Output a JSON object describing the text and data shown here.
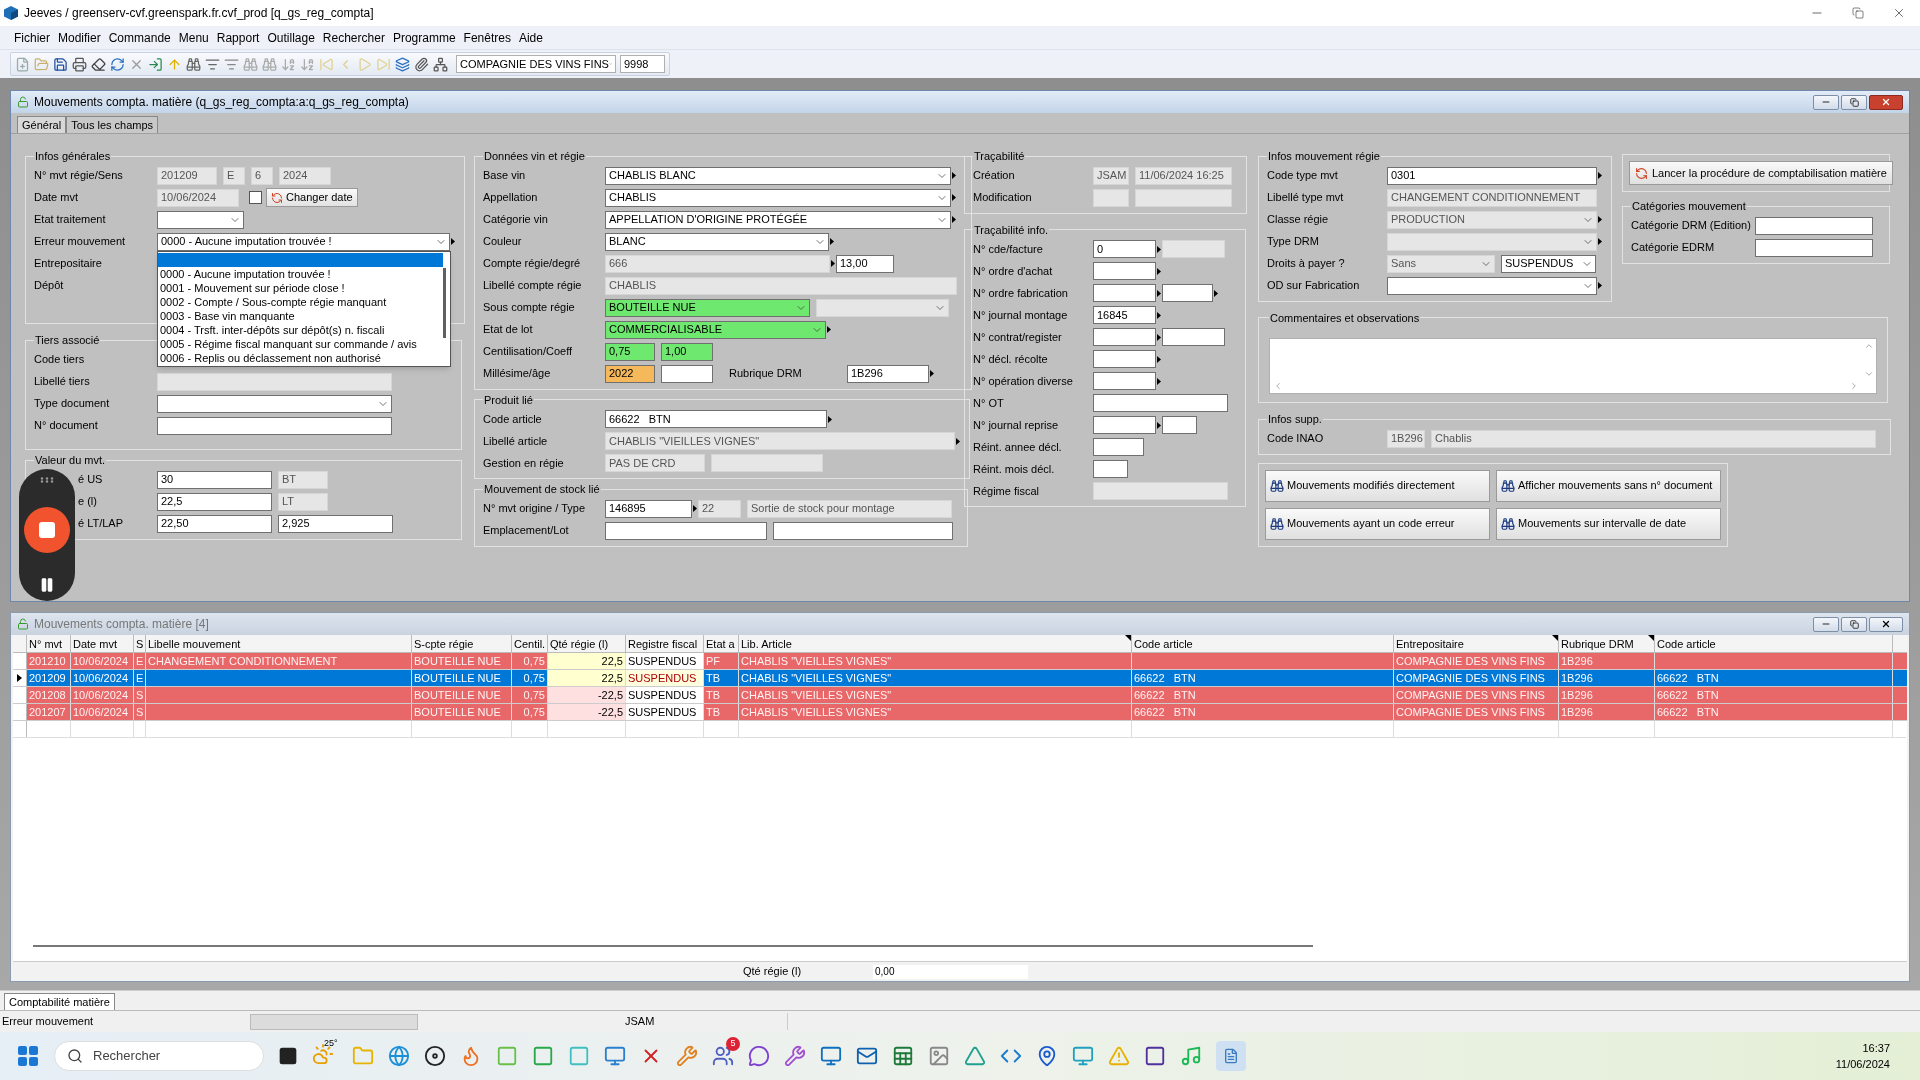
{
  "app": {
    "title": "Jeeves / greenserv-cvf.greenspark.fr.cvf_prod [q_gs_reg_compta]"
  },
  "menu": [
    "Fichier",
    "Modifier",
    "Commande",
    "Menu",
    "Rapport",
    "Outillage",
    "Rechercher",
    "Programme",
    "Fenêtres",
    "Aide"
  ],
  "toolbar": {
    "company": "COMPAGNIE DES VINS FINS",
    "code": "9998"
  },
  "form_window": {
    "title": "Mouvements compta. matière (q_gs_reg_compta:a:q_gs_reg_compta)",
    "tabs": [
      {
        "label": "Général",
        "selected": true
      },
      {
        "label": "Tous les champs",
        "selected": false
      }
    ],
    "infos_generales": {
      "title": "Infos générales",
      "rows": [
        {
          "label": "N° mvt régie/Sens",
          "fields": [
            {
              "kind": "input",
              "readonly": true,
              "link": false,
              "value": "201209"
            },
            {
              "kind": "input",
              "readonly": true,
              "link": false,
              "value": "E"
            },
            {
              "kind": "input",
              "readonly": true,
              "link": false,
              "value": "6"
            },
            {
              "kind": "input",
              "readonly": true,
              "link": false,
              "value": "2024"
            }
          ]
        },
        {
          "label": "Date mvt",
          "fields": [
            {
              "kind": "input",
              "readonly": true,
              "link": false,
              "value": "10/06/2024"
            }
          ],
          "checkbox": {
            "checked": false
          },
          "button": "Changer date"
        },
        {
          "label": "Etat traitement",
          "fields": [
            {
              "kind": "select",
              "readonly": false,
              "link": false
            }
          ]
        },
        {
          "label": "Erreur mouvement",
          "fields": [
            {
              "kind": "select",
              "readonly": false,
              "link": true,
              "value": "0000 - Aucune imputation trouvée !"
            }
          ],
          "dropdown": [
            {
              "selected": true
            },
            {
              "label": "0000 - Aucune imputation trouvée !",
              "selected": false
            },
            {
              "label": "0001 - Mouvement sur période close !",
              "selected": false
            },
            {
              "label": "0002 - Compte / Sous-compte régie manquant",
              "selected": false
            },
            {
              "label": "0003 - Base vin manquante",
              "selected": false
            },
            {
              "label": "0004 - Trsft. inter-dépôts sur dépôt(s) n. fiscali",
              "selected": false
            },
            {
              "label": "0005 - Régime fiscal manquant sur commande / avis",
              "selected": false
            },
            {
              "label": "0006 - Replis ou déclassement non authorisé",
              "selected": false
            }
          ]
        },
        {
          "label": "Entrepositaire"
        },
        {
          "label": "Dépôt"
        }
      ]
    },
    "tiers": {
      "title": "Tiers associé",
      "rows": [
        {
          "label": "Code tiers"
        },
        {
          "label": "Libellé tiers",
          "fields": [
            {
              "kind": "input",
              "readonly": true,
              "link": false
            }
          ]
        },
        {
          "label": "Type document",
          "fields": [
            {
              "kind": "select",
              "readonly": false,
              "link": false
            }
          ]
        },
        {
          "label": "N° document",
          "fields": [
            {
              "kind": "input",
              "readonly": false,
              "link": false
            }
          ]
        }
      ]
    },
    "valeur": {
      "title": "Valeur du mvt.",
      "rows": [
        {
          "label": "é US",
          "fields": [
            {
              "kind": "input",
              "readonly": false,
              "link": false,
              "value": "30"
            },
            {
              "kind": "input",
              "readonly": true,
              "link": false,
              "value": "BT"
            }
          ]
        },
        {
          "label": "e (l)",
          "fields": [
            {
              "kind": "input",
              "readonly": false,
              "link": false,
              "value": "22,5"
            },
            {
              "kind": "input",
              "readonly": true,
              "link": false,
              "value": "LT"
            }
          ]
        },
        {
          "label": "é LT/LAP",
          "fields": [
            {
              "kind": "input",
              "readonly": false,
              "link": false,
              "value": "22,50"
            },
            {
              "kind": "input",
              "readonly": false,
              "link": false,
              "value": "2,925"
            }
          ]
        }
      ]
    },
    "vin": {
      "title": "Données vin et régie",
      "rows": [
        {
          "label": "Base vin",
          "fields": [
            {
              "kind": "select",
              "readonly": false,
              "link": true,
              "value": "CHABLIS BLANC"
            }
          ]
        },
        {
          "label": "Appellation",
          "fields": [
            {
              "kind": "select",
              "readonly": false,
              "link": true,
              "value": "CHABLIS"
            }
          ]
        },
        {
          "label": "Catégorie vin",
          "fields": [
            {
              "kind": "select",
              "readonly": false,
              "link": true,
              "value": "APPELLATION D'ORIGINE PROTÉGÉE"
            }
          ]
        },
        {
          "label": "Couleur",
          "fields": [
            {
              "kind": "select",
              "readonly": false,
              "link": true,
              "value": "BLANC"
            }
          ]
        },
        {
          "label": "Compte régie/degré",
          "fields": [
            {
              "kind": "input",
              "readonly": true,
              "link": true,
              "value": "666"
            },
            {
              "kind": "input",
              "readonly": false,
              "link": false,
              "value": "13,00"
            }
          ]
        },
        {
          "label": "Libellé compte régie",
          "fields": [
            {
              "kind": "input",
              "readonly": true,
              "link": false,
              "value": "CHABLIS"
            }
          ]
        },
        {
          "label": "Sous compte régie",
          "fields": [
            {
              "kind": "select",
              "readonly": false,
              "link": false,
              "value": "BOUTEILLE NUE",
              "color": "#6ee86e"
            },
            {
              "kind": "select",
              "readonly": true,
              "link": false
            }
          ]
        },
        {
          "label": "Etat de lot",
          "fields": [
            {
              "kind": "select",
              "readonly": false,
              "link": true,
              "value": "COMMERCIALISABLE",
              "color": "#6ee86e"
            }
          ]
        },
        {
          "label": "Centilisation/Coeff",
          "fields": [
            {
              "kind": "input",
              "readonly": false,
              "link": false,
              "value": "0,75",
              "color": "#6ee86e"
            },
            {
              "kind": "input",
              "readonly": false,
              "link": false,
              "value": "1,00",
              "color": "#6ee86e"
            }
          ]
        },
        {
          "label": "Millésime/âge",
          "fields": [
            {
              "kind": "input",
              "readonly": false,
              "link": false,
              "value": "2022",
              "color": "#f5b95c"
            },
            {
              "kind": "input",
              "readonly": false,
              "link": false
            }
          ],
          "label2": "Rubrique DRM",
          "fields2": [
            {
              "kind": "input",
              "readonly": false,
              "link": true,
              "value": "1B296"
            }
          ]
        }
      ]
    },
    "produit": {
      "title": "Produit lié",
      "rows": [
        {
          "label": "Code article",
          "fields": [
            {
              "kind": "input",
              "readonly": false,
              "link": true,
              "value": "66622   BTN"
            }
          ]
        },
        {
          "label": "Libellé article",
          "fields": [
            {
              "kind": "input",
              "readonly": true,
              "link": true,
              "value": "CHABLIS \"VIEILLES VIGNES\""
            }
          ]
        },
        {
          "label": "Gestion en régie",
          "fields": [
            {
              "kind": "input",
              "readonly": true,
              "link": false,
              "value": "PAS DE CRD"
            },
            {
              "kind": "input",
              "readonly": true,
              "link": false
            }
          ]
        }
      ]
    },
    "stock": {
      "title": "Mouvement de stock lié",
      "rows": [
        {
          "label": "N° mvt origine / Type",
          "fields": [
            {
              "kind": "input",
              "readonly": false,
              "link": true,
              "value": "146895"
            },
            {
              "kind": "input",
              "readonly": true,
              "link": false,
              "value": "22"
            },
            {
              "kind": "input",
              "readonly": true,
              "link": false,
              "value": "Sortie de stock pour montage"
            }
          ]
        },
        {
          "label": "Emplacement/Lot",
          "fields": [
            {
              "kind": "input",
              "readonly": false,
              "link": false
            },
            {
              "kind": "input",
              "readonly": false,
              "link": false
            }
          ]
        }
      ]
    },
    "tracabilite": {
      "title": "Traçabilité",
      "rows": [
        {
          "label": "Création",
          "fields": [
            {
              "kind": "input",
              "readonly": true,
              "link": false,
              "value": "JSAM"
            },
            {
              "kind": "input",
              "readonly": true,
              "link": false,
              "value": "11/06/2024 16:25"
            }
          ]
        },
        {
          "label": "Modification",
          "fields": [
            {
              "kind": "input",
              "readonly": true,
              "link": false
            },
            {
              "kind": "input",
              "readonly": true,
              "link": false
            }
          ]
        }
      ]
    },
    "tracabilite_info": {
      "title": "Traçabilité info.",
      "rows": [
        {
          "label": "N° cde/facture",
          "fields": [
            {
              "kind": "input",
              "readonly": false,
              "link": true,
              "value": "0"
            },
            {
              "kind": "input",
              "readonly": true,
              "link": false
            }
          ]
        },
        {
          "label": "N° ordre d'achat",
          "fields": [
            {
              "kind": "input",
              "readonly": false,
              "link": true
            }
          ]
        },
        {
          "label": "N° ordre fabrication",
          "fields": [
            {
              "kind": "input",
              "readonly": false,
              "link": true
            },
            {
              "kind": "input",
              "readonly": false,
              "link": true
            }
          ]
        },
        {
          "label": "N° journal montage",
          "fields": [
            {
              "kind": "input",
              "readonly": false,
              "link": true,
              "value": "16845"
            }
          ]
        },
        {
          "label": "N° contrat/register",
          "fields": [
            {
              "kind": "input",
              "readonly": false,
              "link": true
            },
            {
              "kind": "input",
              "readonly": false,
              "link": false
            }
          ]
        },
        {
          "label": "N° décl. récolte",
          "fields": [
            {
              "kind": "input",
              "readonly": false,
              "link": true
            }
          ]
        },
        {
          "label": "N° opération diverse",
          "fields": [
            {
              "kind": "input",
              "readonly": false,
              "link": true
            }
          ]
        },
        {
          "label": "N° OT",
          "fields": [
            {
              "kind": "input",
              "readonly": false,
              "link": false
            }
          ]
        },
        {
          "label": "N° journal reprise",
          "fields": [
            {
              "kind": "input",
              "readonly": false,
              "link": true
            },
            {
              "kind": "input",
              "readonly": false,
              "link": false
            }
          ]
        },
        {
          "label": "Réint. annee décl.",
          "fields": [
            {
              "kind": "input",
              "readonly": false,
              "link": false
            }
          ]
        },
        {
          "label": "Réint. mois décl.",
          "fields": [
            {
              "kind": "input",
              "readonly": false,
              "link": false
            }
          ]
        },
        {
          "label": "Régime fiscal",
          "fields": [
            {
              "kind": "input",
              "readonly": true,
              "link": false
            }
          ]
        }
      ]
    },
    "infos_mouvement": {
      "title": "Infos mouvement régie",
      "rows": [
        {
          "label": "Code type mvt",
          "fields": [
            {
              "kind": "input",
              "readonly": false,
              "link": true,
              "value": "0301"
            }
          ]
        },
        {
          "label": "Libellé type mvt",
          "fields": [
            {
              "kind": "input",
              "readonly": true,
              "link": false,
              "value": "CHANGEMENT CONDITIONNEMENT"
            }
          ]
        },
        {
          "label": "Classe régie",
          "fields": [
            {
              "kind": "select",
              "readonly": true,
              "link": true,
              "value": "PRODUCTION"
            }
          ]
        },
        {
          "label": "Type DRM",
          "fields": [
            {
              "kind": "select",
              "readonly": true,
              "link": true
            }
          ]
        },
        {
          "label": "Droits à payer ?",
          "fields": [
            {
              "kind": "select",
              "readonly": true,
              "link": false,
              "value": "Sans"
            },
            {
              "kind": "select",
              "readonly": false,
              "link": false,
              "value": "SUSPENDUS"
            }
          ]
        },
        {
          "label": "OD sur Fabrication",
          "fields": [
            {
              "kind": "select",
              "readonly": false,
              "link": true
            }
          ]
        }
      ]
    },
    "launch_button": "Lancer la procédure de comptabilisation matière",
    "categories": {
      "title": "Catégories mouvement",
      "rows": [
        {
          "label": "Catégorie DRM (Edition)",
          "fields": [
            {
              "kind": "input",
              "readonly": false,
              "link": false
            }
          ]
        },
        {
          "label": "Catégorie EDRM",
          "fields": [
            {
              "kind": "input",
              "readonly": false,
              "link": false
            }
          ]
        }
      ]
    },
    "comments": {
      "title": "Commentaires et observations"
    },
    "infos_supp": {
      "title": "Infos supp.",
      "rows": [
        {
          "label": "Code INAO",
          "fields": [
            {
              "kind": "input",
              "readonly": true,
              "link": false,
              "value": "1B296"
            },
            {
              "kind": "input",
              "readonly": true,
              "link": false,
              "value": "Chablis"
            }
          ]
        }
      ]
    },
    "search_buttons": [
      "Mouvements modifiés directement",
      "Afficher mouvements sans n° document",
      "Mouvements ayant un code erreur",
      "Mouvements sur intervalle de date"
    ]
  },
  "table_window": {
    "title": "Mouvements compta. matière [4]",
    "columns": [
      {
        "label": "N° mvt",
        "flag": false
      },
      {
        "label": "Date mvt",
        "flag": false
      },
      {
        "label": "S",
        "flag": false
      },
      {
        "label": "Libelle mouvement",
        "flag": false
      },
      {
        "label": "S-cpte régie",
        "flag": false
      },
      {
        "label": "Centil.",
        "flag": false
      },
      {
        "label": "Qté régie (l)",
        "flag": false
      },
      {
        "label": "Registre fiscal",
        "flag": false
      },
      {
        "label": "Etat a",
        "flag": false
      },
      {
        "label": "Lib. Article",
        "flag": true
      },
      {
        "label": "Code article",
        "flag": false
      },
      {
        "label": "Entrepositaire",
        "flag": true
      },
      {
        "label": "Rubrique DRM",
        "flag": true
      },
      {
        "label": "Code article",
        "flag": false
      }
    ],
    "rows": [
      {
        "selected": false,
        "error": true,
        "color": "#ffffd0",
        "cells": [
          "201210",
          "10/06/2024",
          "E",
          "CHANGEMENT CONDITIONNEMENT",
          "BOUTEILLE NUE",
          "0,75",
          "22,5",
          "SUSPENDUS",
          "PF",
          "CHABLIS \"VIEILLES VIGNES\"",
          null,
          "COMPAGNIE DES VINS FINS",
          "1B296",
          null
        ]
      },
      {
        "selected": true,
        "error": true,
        "color": "#ffffd0",
        "cells": [
          "201209",
          "10/06/2024",
          "E",
          null,
          "BOUTEILLE NUE",
          "0,75",
          "22,5",
          "SUSPENDUS",
          "TB",
          "CHABLIS \"VIEILLES VIGNES\"",
          "66622   BTN",
          "COMPAGNIE DES VINS FINS",
          "1B296",
          "66622   BTN"
        ]
      },
      {
        "selected": false,
        "error": true,
        "color": "#ffe0e0",
        "cells": [
          "201208",
          "10/06/2024",
          "S",
          null,
          "BOUTEILLE NUE",
          "0,75",
          "-22,5",
          "SUSPENDUS",
          "TB",
          "CHABLIS \"VIEILLES VIGNES\"",
          "66622   BTN",
          "COMPAGNIE DES VINS FINS",
          "1B296",
          "66622   BTN"
        ]
      },
      {
        "selected": false,
        "error": true,
        "color": "#ffe0e0",
        "cells": [
          "201207",
          "10/06/2024",
          "S",
          null,
          "BOUTEILLE NUE",
          "0,75",
          "-22,5",
          "SUSPENDUS",
          "TB",
          "CHABLIS \"VIEILLES VIGNES\"",
          "66622   BTN",
          "COMPAGNIE DES VINS FINS",
          "1B296",
          "66622   BTN"
        ]
      }
    ],
    "total_label": "Qté régie (l)",
    "total_value": "0,00"
  },
  "bottom_tabs": [
    {
      "label": "Comptabilité matière",
      "selected": true
    }
  ],
  "status_bar": {
    "message": "Erreur mouvement",
    "user": "JSAM"
  },
  "taskbar": {
    "search": "Rechercher",
    "weather": "25°",
    "badge": "5",
    "time": "16:37",
    "date": "11/06/2024"
  }
}
